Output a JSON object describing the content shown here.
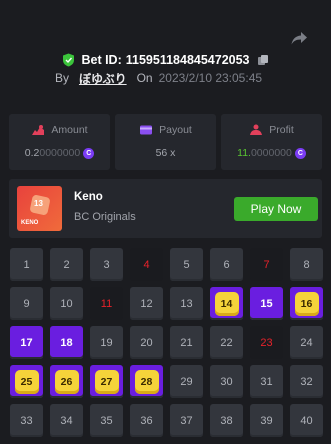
{
  "header": {
    "bet_id_label": "Bet ID:",
    "bet_id": "115951184845472053",
    "by_label": "By",
    "username": "ぼゆぶり",
    "on_label": "On",
    "date": "2023/2/10 23:05:45"
  },
  "stats": [
    {
      "label": "Amount",
      "value_main": "0.2",
      "value_dim": "0000000",
      "icon": "amount-icon"
    },
    {
      "label": "Payout",
      "value_main": "56 x",
      "icon": "payout-icon"
    },
    {
      "label": "Profit",
      "value_main": "11.",
      "value_dim": "0000000",
      "icon": "profit-icon"
    }
  ],
  "coin_symbol": "C",
  "game": {
    "name": "Keno",
    "provider": "BC Originals",
    "thumb_label": "KENO",
    "thumb_number": "13",
    "play_label": "Play Now"
  },
  "colors": {
    "accent": "#6a1ee0",
    "hit": "#f5d33a",
    "miss": "#e8222a",
    "play": "#3aaa2b",
    "profit": "#58c431"
  },
  "grid": {
    "rows": [
      [
        {
          "n": "1",
          "s": "normal"
        },
        {
          "n": "2",
          "s": "normal"
        },
        {
          "n": "3",
          "s": "normal"
        },
        {
          "n": "4",
          "s": "miss"
        },
        {
          "n": "5",
          "s": "normal"
        },
        {
          "n": "6",
          "s": "normal"
        },
        {
          "n": "7",
          "s": "miss"
        },
        {
          "n": "8",
          "s": "normal"
        }
      ],
      [
        {
          "n": "9",
          "s": "normal"
        },
        {
          "n": "10",
          "s": "normal"
        },
        {
          "n": "11",
          "s": "miss"
        },
        {
          "n": "12",
          "s": "normal"
        },
        {
          "n": "13",
          "s": "normal"
        },
        {
          "n": "14",
          "s": "hit"
        },
        {
          "n": "15",
          "s": "sel"
        },
        {
          "n": "16",
          "s": "hit"
        }
      ],
      [
        {
          "n": "17",
          "s": "sel"
        },
        {
          "n": "18",
          "s": "sel"
        },
        {
          "n": "19",
          "s": "normal"
        },
        {
          "n": "20",
          "s": "normal"
        },
        {
          "n": "21",
          "s": "normal"
        },
        {
          "n": "22",
          "s": "normal"
        },
        {
          "n": "23",
          "s": "miss"
        },
        {
          "n": "24",
          "s": "normal"
        }
      ],
      [
        {
          "n": "25",
          "s": "hit"
        },
        {
          "n": "26",
          "s": "hit"
        },
        {
          "n": "27",
          "s": "hit"
        },
        {
          "n": "28",
          "s": "hit"
        },
        {
          "n": "29",
          "s": "normal"
        },
        {
          "n": "30",
          "s": "normal"
        },
        {
          "n": "31",
          "s": "normal"
        },
        {
          "n": "32",
          "s": "normal"
        }
      ],
      [
        {
          "n": "33",
          "s": "normal"
        },
        {
          "n": "34",
          "s": "normal"
        },
        {
          "n": "35",
          "s": "normal"
        },
        {
          "n": "36",
          "s": "normal"
        },
        {
          "n": "37",
          "s": "normal"
        },
        {
          "n": "38",
          "s": "normal"
        },
        {
          "n": "39",
          "s": "normal"
        },
        {
          "n": "40",
          "s": "normal"
        }
      ]
    ]
  }
}
